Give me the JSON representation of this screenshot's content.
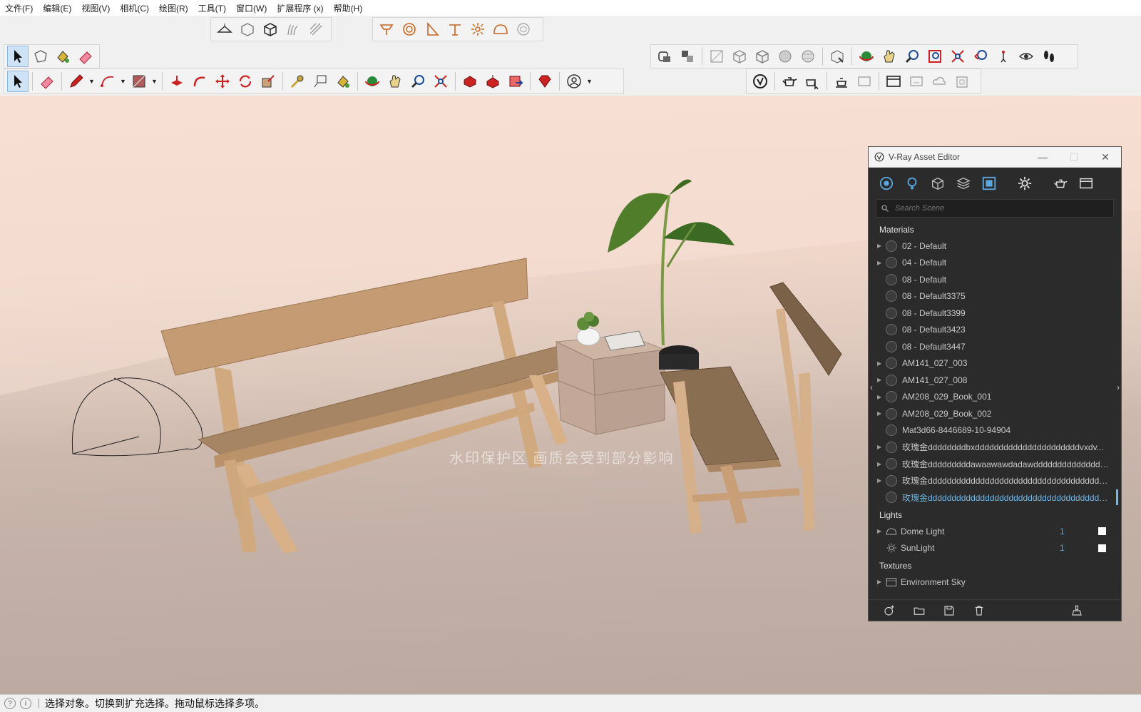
{
  "menu": [
    "文件(F)",
    "编辑(E)",
    "视图(V)",
    "相机(C)",
    "绘图(R)",
    "工具(T)",
    "窗口(W)",
    "扩展程序 (x)",
    "帮助(H)"
  ],
  "status": {
    "message": "选择对象。切换到扩充选择。拖动鼠标选择多项。"
  },
  "viewport": {
    "watermark": "水印保护区   画质会受到部分影响"
  },
  "vray": {
    "title": "V-Ray Asset Editor",
    "search_placeholder": "Search Scene",
    "sections": {
      "materials": "Materials",
      "lights": "Lights",
      "textures": "Textures"
    },
    "materials": [
      {
        "name": "02 - Default",
        "expandable": true
      },
      {
        "name": "04 - Default",
        "expandable": true
      },
      {
        "name": "08 - Default",
        "expandable": false
      },
      {
        "name": "08 - Default3375",
        "expandable": false
      },
      {
        "name": "08 - Default3399",
        "expandable": false
      },
      {
        "name": "08 - Default3423",
        "expandable": false
      },
      {
        "name": "08 - Default3447",
        "expandable": false
      },
      {
        "name": "AM141_027_003",
        "expandable": true
      },
      {
        "name": "AM141_027_008",
        "expandable": true
      },
      {
        "name": "AM208_029_Book_001",
        "expandable": true
      },
      {
        "name": "AM208_029_Book_002",
        "expandable": true
      },
      {
        "name": "Mat3d66-8446689-10-94904",
        "expandable": false
      },
      {
        "name": "玫瑰金ddddddddbxddddddddddddddddddddddvxdv...",
        "expandable": true
      },
      {
        "name": "玫瑰金dddddddddawaawawdadawddddddddddddddd...",
        "expandable": true
      },
      {
        "name": "玫瑰金ddddddddddddddddddddddddddddddddddddd...",
        "expandable": true
      },
      {
        "name": "玫瑰金ddddddddddddddddddddddddddddddddddddd...",
        "expandable": false,
        "selected": true
      }
    ],
    "lights": [
      {
        "name": "Dome Light",
        "count": "1"
      },
      {
        "name": "SunLight",
        "count": "1"
      }
    ],
    "textures": [
      {
        "name": "Environment Sky"
      }
    ]
  },
  "colors": {
    "accent": "#6fb8e8",
    "panel": "#2b2b2b",
    "wood": "#c9a27a",
    "icon_orange": "#c8641e"
  }
}
